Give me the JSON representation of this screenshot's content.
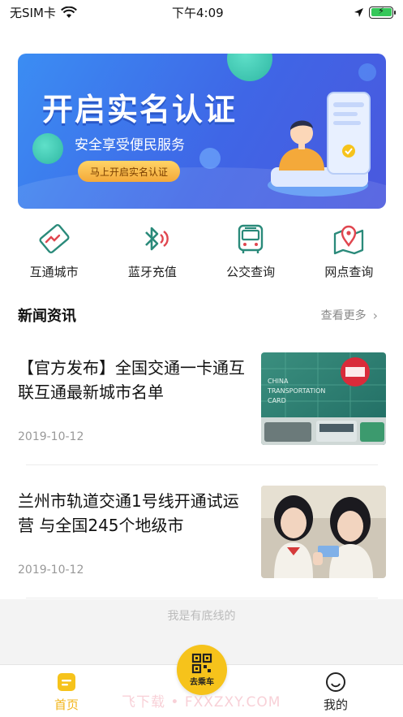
{
  "status_bar": {
    "carrier": "无SIM卡",
    "time": "下午4:09"
  },
  "banner": {
    "title": "开启实名认证",
    "subtitle": "安全享受便民服务",
    "button_label": "马上开启实名认证",
    "colors": {
      "accent": "#3f66e6",
      "button": "#f4a93a"
    }
  },
  "quick_actions": [
    {
      "label": "互通城市",
      "icon": "handshake-card-icon"
    },
    {
      "label": "蓝牙充值",
      "icon": "bluetooth-icon"
    },
    {
      "label": "公交查询",
      "icon": "bus-icon"
    },
    {
      "label": "网点查询",
      "icon": "map-pin-icon"
    }
  ],
  "news": {
    "section_title": "新闻资讯",
    "see_more": "查看更多",
    "items": [
      {
        "headline": "【官方发布】全国交通一卡通互联互通最新城市名单",
        "date": "2019-10-12"
      },
      {
        "headline": "兰州市轨道交通1号线开通试运营 与全国245个地级市",
        "date": "2019-10-12"
      }
    ]
  },
  "bottom_line_text": "我是有底线的",
  "tabbar": {
    "home": "首页",
    "ride": "去乘车",
    "mine": "我的",
    "active_color": "#f2b418"
  },
  "watermark": "飞下载 • FXXZXY.COM"
}
